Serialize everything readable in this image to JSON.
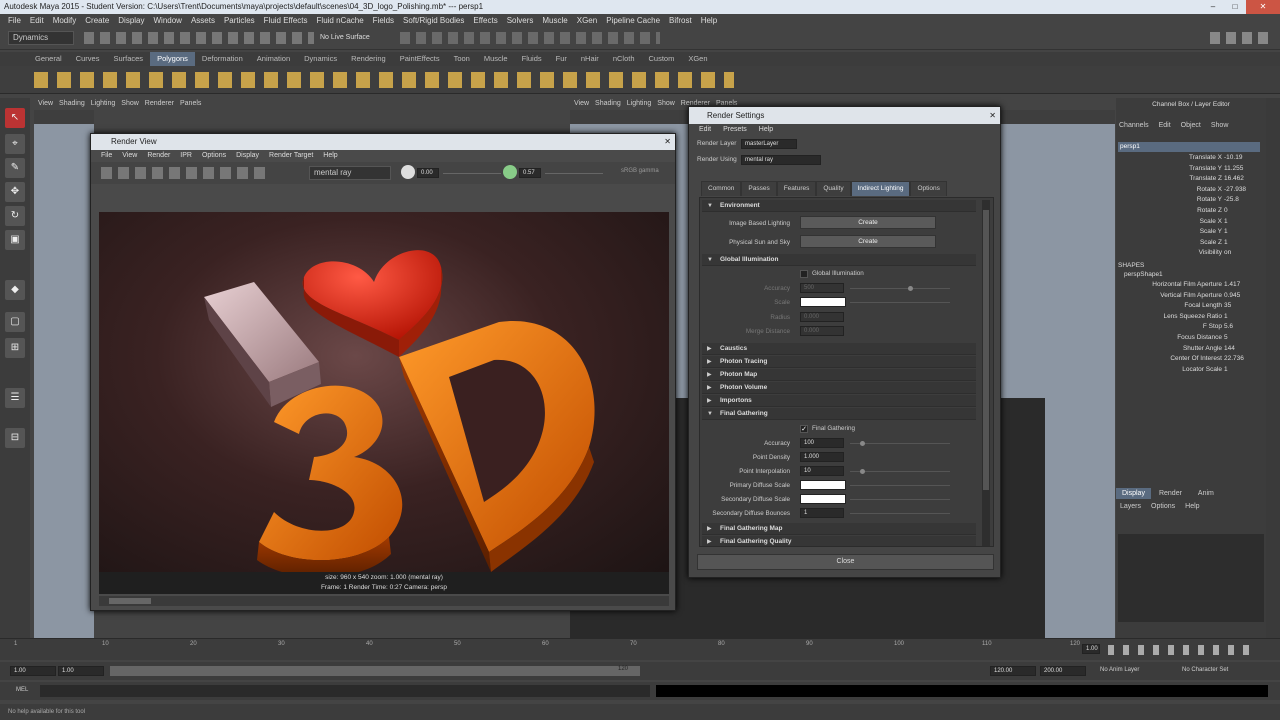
{
  "window": {
    "title": "Autodesk Maya 2015 - Student Version: C:\\Users\\Trent\\Documents\\maya\\projects\\default\\scenes\\04_3D_logo_Polishing.mb* --- persp1",
    "min": "–",
    "max": "□",
    "close": "✕"
  },
  "menubar": [
    "File",
    "Edit",
    "Modify",
    "Create",
    "Display",
    "Window",
    "Assets",
    "Particles",
    "Fluid Effects",
    "Fluid nCache",
    "Fields",
    "Soft/Rigid Bodies",
    "Effects",
    "Solvers",
    "Muscle",
    "XGen",
    "Pipeline Cache",
    "Bifrost",
    "Help"
  ],
  "status": {
    "mode": "Dynamics",
    "live_surface": "No Live Surface"
  },
  "shelf_tabs": [
    "General",
    "Curves",
    "Surfaces",
    "Polygons",
    "Deformation",
    "Animation",
    "Dynamics",
    "Rendering",
    "PaintEffects",
    "Toon",
    "Muscle",
    "Fluids",
    "Fur",
    "nHair",
    "nCloth",
    "Custom",
    "XGen"
  ],
  "shelf_active": "Polygons",
  "viewport_menu": [
    "View",
    "Shading",
    "Lighting",
    "Show",
    "Renderer",
    "Panels"
  ],
  "render_view": {
    "title": "Render View",
    "menu": [
      "File",
      "View",
      "Render",
      "IPR",
      "Options",
      "Display",
      "Render Target",
      "Help"
    ],
    "renderer": "mental ray",
    "exposure": "0.00",
    "gamma": "0.57",
    "rgb": "sRGB gamma",
    "status_line1": "size: 960 x 540  zoom: 1.000      (mental ray)",
    "status_line2": "Frame: 1        Render Time: 0:27        Camera: persp"
  },
  "render_settings": {
    "title": "Render Settings",
    "menu": [
      "Edit",
      "Presets",
      "Help"
    ],
    "render_layer_label": "Render Layer",
    "render_layer_value": "masterLayer",
    "render_using_label": "Render Using",
    "render_using_value": "mental ray",
    "tabs": [
      "Common",
      "Passes",
      "Features",
      "Quality",
      "Indirect Lighting",
      "Options"
    ],
    "active_tab": "Indirect Lighting",
    "environment": "Environment",
    "ibl_label": "Image Based Lighting",
    "psky_label": "Physical Sun and Sky",
    "create": "Create",
    "global_illumination": "Global Illumination",
    "gi_check": "Global Illumination",
    "accuracy_label": "Accuracy",
    "accuracy_value": "500",
    "scale_label": "Scale",
    "radius_label": "Radius",
    "radius_value": "0.000",
    "merge_label": "Merge Distance",
    "merge_value": "0.000",
    "collapsed": [
      "Caustics",
      "Photon Tracing",
      "Photon Map",
      "Photon Volume",
      "Importons"
    ],
    "final_gathering": "Final Gathering",
    "fg_check": "Final Gathering",
    "fg_accuracy_label": "Accuracy",
    "fg_accuracy": "100",
    "point_density_label": "Point Density",
    "point_density": "1.000",
    "point_interp_label": "Point Interpolation",
    "point_interp": "10",
    "primary_diffuse_label": "Primary Diffuse Scale",
    "secondary_diffuse_label": "Secondary Diffuse Scale",
    "secondary_bounces_label": "Secondary Diffuse Bounces",
    "secondary_bounces": "1",
    "fg_map": "Final Gathering Map",
    "fg_quality": "Final Gathering Quality",
    "close": "Close"
  },
  "channel_box": {
    "header": "Channel Box / Layer Editor",
    "menu": [
      "Channels",
      "Edit",
      "Object",
      "Show"
    ],
    "object": "persp1",
    "attrs": [
      [
        "Translate X",
        "-10.19"
      ],
      [
        "Translate Y",
        "11.255"
      ],
      [
        "Translate Z",
        "16.462"
      ],
      [
        "Rotate X",
        "-27.938"
      ],
      [
        "Rotate Y",
        "-25.8"
      ],
      [
        "Rotate Z",
        "0"
      ],
      [
        "Scale X",
        "1"
      ],
      [
        "Scale Y",
        "1"
      ],
      [
        "Scale Z",
        "1"
      ],
      [
        "Visibility",
        "on"
      ]
    ],
    "shapes_label": "SHAPES",
    "shape_name": "perspShape1",
    "shape_attrs": [
      [
        "Horizontal Film Aperture",
        "1.417"
      ],
      [
        "Vertical Film Aperture",
        "0.945"
      ],
      [
        "Focal Length",
        "35"
      ],
      [
        "Lens Squeeze Ratio",
        "1"
      ],
      [
        "F Stop",
        "5.6"
      ],
      [
        "Focus Distance",
        "5"
      ],
      [
        "Shutter Angle",
        "144"
      ],
      [
        "Center Of Interest",
        "22.736"
      ],
      [
        "Locator Scale",
        "1"
      ]
    ]
  },
  "layer_editor": {
    "tabs": [
      "Display",
      "Render",
      "Anim"
    ],
    "menu": [
      "Layers",
      "Options",
      "Help"
    ]
  },
  "time": {
    "ticks": [
      "1",
      "10",
      "20",
      "30",
      "40",
      "50",
      "60",
      "70",
      "80",
      "90",
      "100",
      "110",
      "120"
    ],
    "current": "1.00",
    "start": "1.00",
    "start2": "1.00",
    "range_end": "120",
    "end": "120.00",
    "end2": "200.00",
    "anim_layer": "No Anim Layer",
    "char_set": "No Character Set"
  },
  "cmd": {
    "label": "MEL"
  },
  "help_line": "No help available for this tool"
}
